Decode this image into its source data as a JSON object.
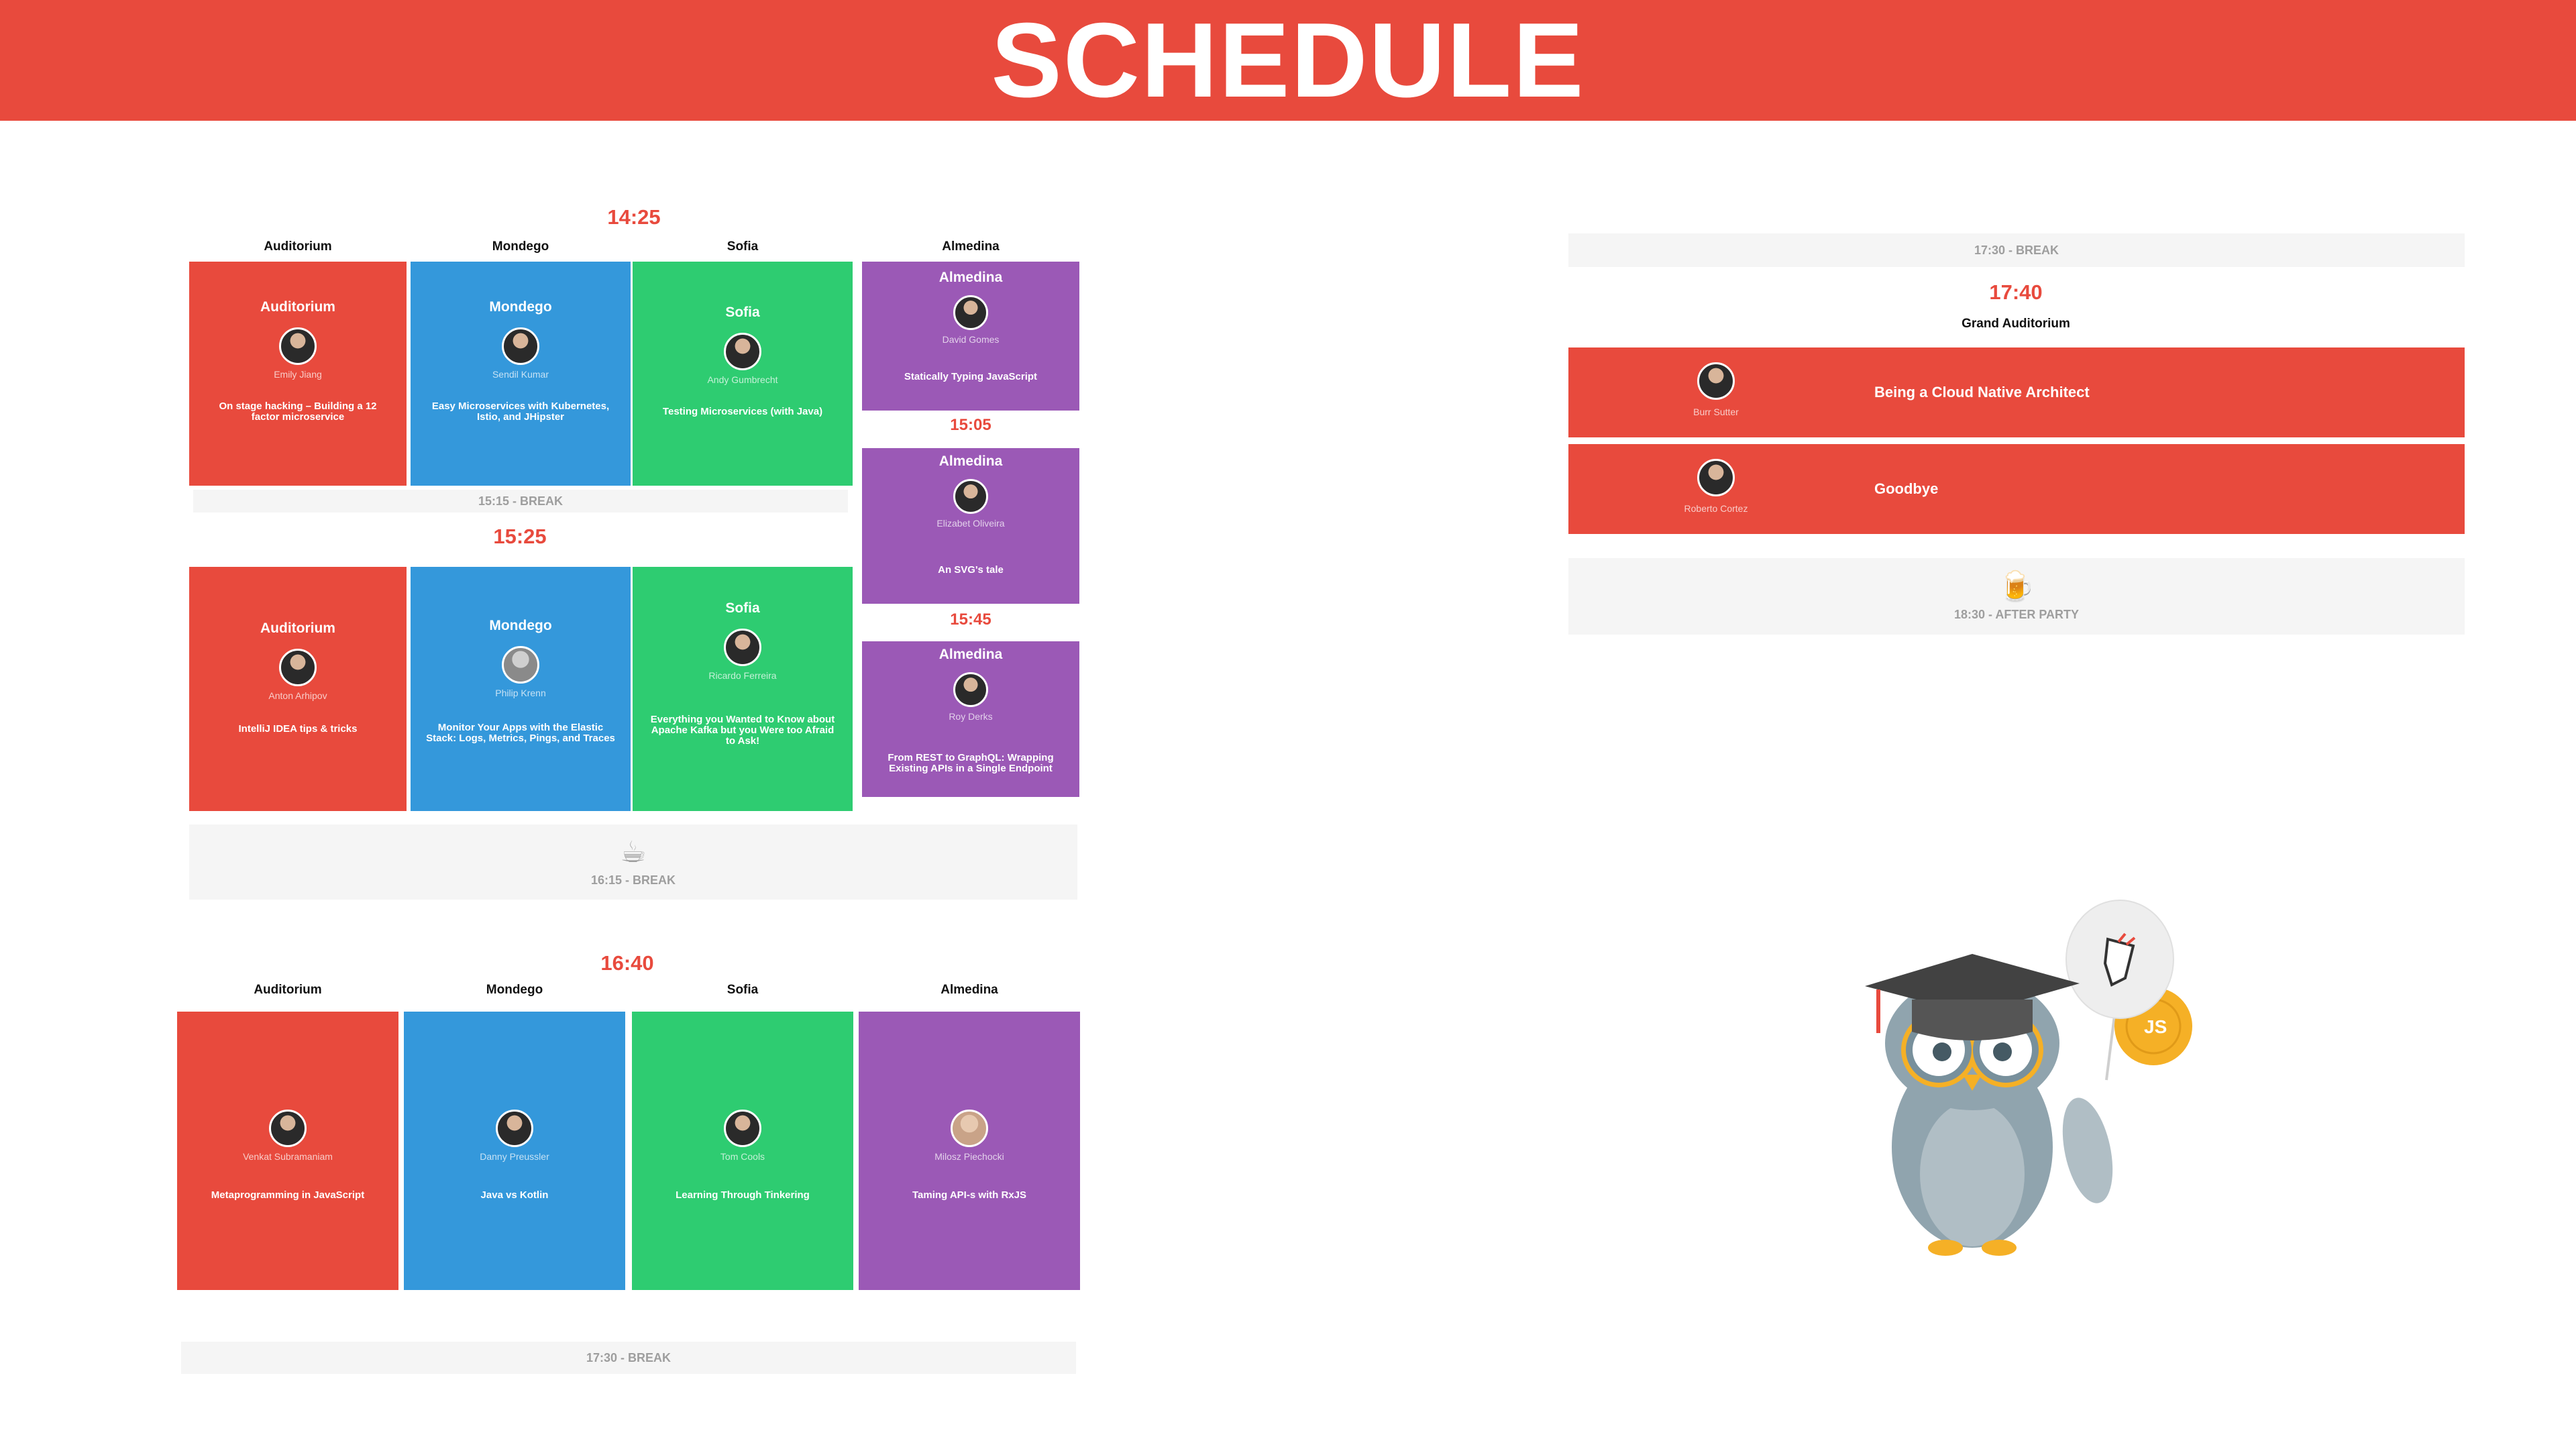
{
  "header": {
    "title": "SCHEDULE"
  },
  "block1": {
    "time": "14:25",
    "rooms": [
      "Auditorium",
      "Mondego",
      "Sofia",
      "Almedina"
    ],
    "sessions": [
      {
        "room": "Auditorium",
        "speaker": "Emily Jiang",
        "title": "On stage hacking – Building a 12 factor microservice"
      },
      {
        "room": "Mondego",
        "speaker": "Sendil Kumar",
        "title": "Easy Microservices with Kubernetes, Istio, and JHipster"
      },
      {
        "room": "Sofia",
        "speaker": "Andy Gumbrecht",
        "title": "Testing Microservices (with Java)"
      },
      {
        "room": "Almedina",
        "speaker": "David Gomes",
        "title": "Statically Typing JavaScript"
      }
    ],
    "break": "15:15 - BREAK"
  },
  "almedina_extra": [
    {
      "time": "15:05",
      "room": "Almedina",
      "speaker": "Elizabet Oliveira",
      "title": "An SVG's tale"
    },
    {
      "time": "15:45",
      "room": "Almedina",
      "speaker": "Roy Derks",
      "title": "From REST to GraphQL: Wrapping Existing APIs in a Single Endpoint"
    }
  ],
  "block2": {
    "time": "15:25",
    "sessions": [
      {
        "room": "Auditorium",
        "speaker": "Anton Arhipov",
        "title": "IntelliJ IDEA tips & tricks"
      },
      {
        "room": "Mondego",
        "speaker": "Philip Krenn",
        "title": "Monitor Your Apps with the Elastic Stack: Logs, Metrics, Pings, and Traces"
      },
      {
        "room": "Sofia",
        "speaker": "Ricardo Ferreira",
        "title": "Everything you Wanted to Know about Apache Kafka but you Were too Afraid to Ask!"
      }
    ],
    "break": {
      "label": "16:15 - BREAK",
      "icon": "coffee-cup-icon"
    }
  },
  "block3": {
    "time": "16:40",
    "rooms": [
      "Auditorium",
      "Mondego",
      "Sofia",
      "Almedina"
    ],
    "sessions": [
      {
        "speaker": "Venkat Subramaniam",
        "title": "Metaprogramming in JavaScript"
      },
      {
        "speaker": "Danny Preussler",
        "title": "Java vs Kotlin"
      },
      {
        "speaker": "Tom Cools",
        "title": "Learning Through Tinkering"
      },
      {
        "speaker": "Milosz Piechocki",
        "title": "Taming API-s with RxJS"
      }
    ],
    "break": "17:30 - BREAK"
  },
  "right": {
    "break_top": "17:30 - BREAK",
    "time": "17:40",
    "room": "Grand Auditorium",
    "sessions": [
      {
        "speaker": "Burr Sutter",
        "title": "Being a Cloud Native Architect"
      },
      {
        "speaker": "Roberto Cortez",
        "title": "Goodbye"
      }
    ],
    "after_party": {
      "label": "18:30 - AFTER PARTY",
      "icon": "beer-mug-icon"
    }
  },
  "mascot": {
    "icon": "graduation-owl-icon",
    "balloon_text": "JS"
  },
  "colors": {
    "auditorium": "#e84a3d",
    "mondego": "#3498db",
    "sofia": "#2ecc71",
    "almedina": "#9b59b6",
    "time": "#e84a3d",
    "break_bg": "#f5f5f5"
  }
}
